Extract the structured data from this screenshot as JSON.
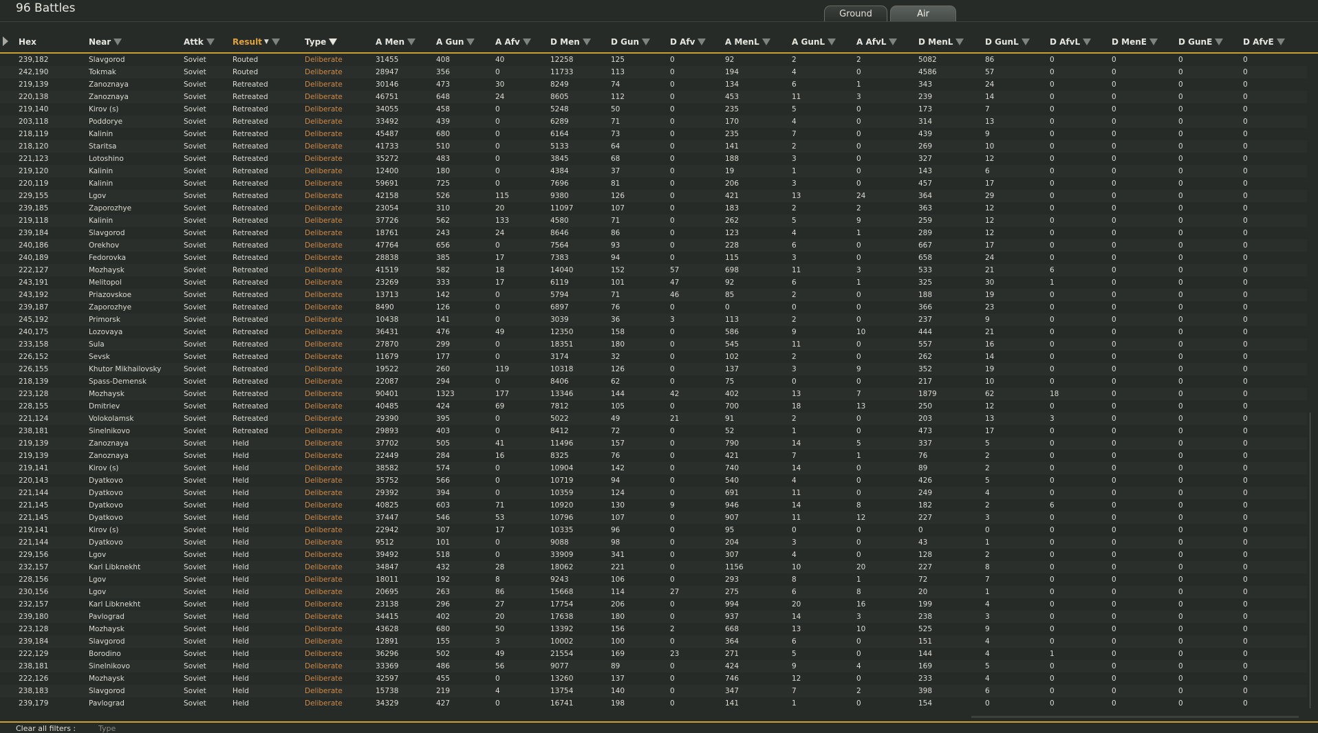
{
  "title": "96 Battles",
  "tabs": [
    {
      "label": "Ground",
      "active": false
    },
    {
      "label": "Air",
      "active": true
    }
  ],
  "colors": {
    "accent": "#c9a233",
    "type_text": "#cf8a4a",
    "active_header": "#e1a23e",
    "background": "#262b28"
  },
  "columns": [
    {
      "key": "hex",
      "label": "Hex",
      "filter": false
    },
    {
      "key": "near",
      "label": "Near",
      "filter": true
    },
    {
      "key": "attk",
      "label": "Attk",
      "filter": true
    },
    {
      "key": "result",
      "label": "Result",
      "filter": true,
      "sorted": "descending",
      "active": true
    },
    {
      "key": "type",
      "label": "Type",
      "filter": true,
      "filter_applied": true
    },
    {
      "key": "a_men",
      "label": "A Men",
      "filter": true
    },
    {
      "key": "a_gun",
      "label": "A Gun",
      "filter": true
    },
    {
      "key": "a_afv",
      "label": "A Afv",
      "filter": true
    },
    {
      "key": "d_men",
      "label": "D Men",
      "filter": true
    },
    {
      "key": "d_gun",
      "label": "D Gun",
      "filter": true
    },
    {
      "key": "d_afv",
      "label": "D Afv",
      "filter": true
    },
    {
      "key": "a_menl",
      "label": "A MenL",
      "filter": true
    },
    {
      "key": "a_gunl",
      "label": "A GunL",
      "filter": true
    },
    {
      "key": "a_afvl",
      "label": "A AfvL",
      "filter": true
    },
    {
      "key": "d_menl",
      "label": "D MenL",
      "filter": true
    },
    {
      "key": "d_gunl",
      "label": "D GunL",
      "filter": true
    },
    {
      "key": "d_afvl",
      "label": "D AfvL",
      "filter": true
    },
    {
      "key": "d_mene",
      "label": "D MenE",
      "filter": true
    },
    {
      "key": "d_gune",
      "label": "D GunE",
      "filter": true
    },
    {
      "key": "d_afve",
      "label": "D AfvE",
      "filter": true
    }
  ],
  "rows": [
    [
      "239,182",
      "Slavgorod",
      "Soviet",
      "Routed",
      "Deliberate",
      "31455",
      "408",
      "40",
      "12258",
      "125",
      "0",
      "92",
      "2",
      "2",
      "5082",
      "86",
      "0",
      "0",
      "0",
      "0"
    ],
    [
      "242,190",
      "Tokmak",
      "Soviet",
      "Routed",
      "Deliberate",
      "28947",
      "356",
      "0",
      "11733",
      "113",
      "0",
      "194",
      "4",
      "0",
      "4586",
      "57",
      "0",
      "0",
      "0",
      "0"
    ],
    [
      "219,139",
      "Zanoznaya",
      "Soviet",
      "Retreated",
      "Deliberate",
      "30146",
      "473",
      "30",
      "8249",
      "74",
      "0",
      "134",
      "6",
      "1",
      "343",
      "24",
      "0",
      "0",
      "0",
      "0"
    ],
    [
      "220,138",
      "Zanoznaya",
      "Soviet",
      "Retreated",
      "Deliberate",
      "46751",
      "648",
      "24",
      "8605",
      "112",
      "0",
      "453",
      "11",
      "3",
      "239",
      "14",
      "0",
      "0",
      "0",
      "0"
    ],
    [
      "219,140",
      "Kirov (s)",
      "Soviet",
      "Retreated",
      "Deliberate",
      "34055",
      "458",
      "0",
      "5248",
      "50",
      "0",
      "235",
      "5",
      "0",
      "173",
      "7",
      "0",
      "0",
      "0",
      "0"
    ],
    [
      "203,118",
      "Poddorye",
      "Soviet",
      "Retreated",
      "Deliberate",
      "33492",
      "439",
      "0",
      "6289",
      "71",
      "0",
      "170",
      "4",
      "0",
      "314",
      "13",
      "0",
      "0",
      "0",
      "0"
    ],
    [
      "218,119",
      "Kalinin",
      "Soviet",
      "Retreated",
      "Deliberate",
      "45487",
      "680",
      "0",
      "6164",
      "73",
      "0",
      "235",
      "7",
      "0",
      "439",
      "9",
      "0",
      "0",
      "0",
      "0"
    ],
    [
      "218,120",
      "Staritsa",
      "Soviet",
      "Retreated",
      "Deliberate",
      "41733",
      "510",
      "0",
      "5133",
      "64",
      "0",
      "141",
      "2",
      "0",
      "269",
      "10",
      "0",
      "0",
      "0",
      "0"
    ],
    [
      "221,123",
      "Lotoshino",
      "Soviet",
      "Retreated",
      "Deliberate",
      "35272",
      "483",
      "0",
      "3845",
      "68",
      "0",
      "188",
      "3",
      "0",
      "327",
      "12",
      "0",
      "0",
      "0",
      "0"
    ],
    [
      "219,120",
      "Kalinin",
      "Soviet",
      "Retreated",
      "Deliberate",
      "12400",
      "180",
      "0",
      "4384",
      "37",
      "0",
      "19",
      "1",
      "0",
      "143",
      "6",
      "0",
      "0",
      "0",
      "0"
    ],
    [
      "220,119",
      "Kalinin",
      "Soviet",
      "Retreated",
      "Deliberate",
      "59691",
      "725",
      "0",
      "7696",
      "81",
      "0",
      "206",
      "3",
      "0",
      "457",
      "17",
      "0",
      "0",
      "0",
      "0"
    ],
    [
      "229,155",
      "Lgov",
      "Soviet",
      "Retreated",
      "Deliberate",
      "42158",
      "526",
      "115",
      "9380",
      "126",
      "0",
      "421",
      "13",
      "24",
      "364",
      "29",
      "0",
      "0",
      "0",
      "0"
    ],
    [
      "239,185",
      "Zaporozhye",
      "Soviet",
      "Retreated",
      "Deliberate",
      "23054",
      "310",
      "20",
      "11097",
      "107",
      "0",
      "183",
      "2",
      "2",
      "363",
      "12",
      "0",
      "0",
      "0",
      "0"
    ],
    [
      "219,118",
      "Kalinin",
      "Soviet",
      "Retreated",
      "Deliberate",
      "37726",
      "562",
      "133",
      "4580",
      "71",
      "0",
      "262",
      "5",
      "9",
      "259",
      "12",
      "0",
      "0",
      "0",
      "0"
    ],
    [
      "239,184",
      "Slavgorod",
      "Soviet",
      "Retreated",
      "Deliberate",
      "18761",
      "243",
      "24",
      "8646",
      "86",
      "0",
      "123",
      "4",
      "1",
      "289",
      "12",
      "0",
      "0",
      "0",
      "0"
    ],
    [
      "240,186",
      "Orekhov",
      "Soviet",
      "Retreated",
      "Deliberate",
      "47764",
      "656",
      "0",
      "7564",
      "93",
      "0",
      "228",
      "6",
      "0",
      "667",
      "17",
      "0",
      "0",
      "0",
      "0"
    ],
    [
      "240,189",
      "Fedorovka",
      "Soviet",
      "Retreated",
      "Deliberate",
      "28838",
      "385",
      "17",
      "7383",
      "94",
      "0",
      "115",
      "3",
      "0",
      "658",
      "24",
      "0",
      "0",
      "0",
      "0"
    ],
    [
      "222,127",
      "Mozhaysk",
      "Soviet",
      "Retreated",
      "Deliberate",
      "41519",
      "582",
      "18",
      "14040",
      "152",
      "57",
      "698",
      "11",
      "3",
      "533",
      "21",
      "6",
      "0",
      "0",
      "0"
    ],
    [
      "243,191",
      "Melitopol",
      "Soviet",
      "Retreated",
      "Deliberate",
      "23269",
      "333",
      "17",
      "6119",
      "101",
      "47",
      "92",
      "6",
      "1",
      "325",
      "30",
      "1",
      "0",
      "0",
      "0"
    ],
    [
      "243,192",
      "Priazovskoe",
      "Soviet",
      "Retreated",
      "Deliberate",
      "13713",
      "142",
      "0",
      "5794",
      "71",
      "46",
      "85",
      "2",
      "0",
      "188",
      "19",
      "0",
      "0",
      "0",
      "0"
    ],
    [
      "239,187",
      "Zaporozhye",
      "Soviet",
      "Retreated",
      "Deliberate",
      "8490",
      "126",
      "0",
      "6897",
      "76",
      "0",
      "0",
      "0",
      "0",
      "366",
      "23",
      "0",
      "0",
      "0",
      "0"
    ],
    [
      "245,192",
      "Primorsk",
      "Soviet",
      "Retreated",
      "Deliberate",
      "10438",
      "141",
      "0",
      "3039",
      "36",
      "3",
      "113",
      "2",
      "0",
      "237",
      "9",
      "0",
      "0",
      "0",
      "0"
    ],
    [
      "240,175",
      "Lozovaya",
      "Soviet",
      "Retreated",
      "Deliberate",
      "36431",
      "476",
      "49",
      "12350",
      "158",
      "0",
      "586",
      "9",
      "10",
      "444",
      "21",
      "0",
      "0",
      "0",
      "0"
    ],
    [
      "233,158",
      "Sula",
      "Soviet",
      "Retreated",
      "Deliberate",
      "27870",
      "299",
      "0",
      "18351",
      "180",
      "0",
      "545",
      "11",
      "0",
      "557",
      "16",
      "0",
      "0",
      "0",
      "0"
    ],
    [
      "226,152",
      "Sevsk",
      "Soviet",
      "Retreated",
      "Deliberate",
      "11679",
      "177",
      "0",
      "3174",
      "32",
      "0",
      "102",
      "2",
      "0",
      "262",
      "14",
      "0",
      "0",
      "0",
      "0"
    ],
    [
      "226,155",
      "Khutor Mikhailovsky",
      "Soviet",
      "Retreated",
      "Deliberate",
      "19522",
      "260",
      "119",
      "10318",
      "126",
      "0",
      "137",
      "3",
      "9",
      "352",
      "19",
      "0",
      "0",
      "0",
      "0"
    ],
    [
      "218,139",
      "Spass-Demensk",
      "Soviet",
      "Retreated",
      "Deliberate",
      "22087",
      "294",
      "0",
      "8406",
      "62",
      "0",
      "75",
      "0",
      "0",
      "217",
      "10",
      "0",
      "0",
      "0",
      "0"
    ],
    [
      "223,128",
      "Mozhaysk",
      "Soviet",
      "Retreated",
      "Deliberate",
      "90401",
      "1323",
      "177",
      "13346",
      "144",
      "42",
      "402",
      "13",
      "7",
      "1879",
      "62",
      "18",
      "0",
      "0",
      "0"
    ],
    [
      "228,155",
      "Dmitriev",
      "Soviet",
      "Retreated",
      "Deliberate",
      "40485",
      "424",
      "69",
      "7812",
      "105",
      "0",
      "700",
      "18",
      "13",
      "250",
      "12",
      "0",
      "0",
      "0",
      "0"
    ],
    [
      "221,124",
      "Volokolamsk",
      "Soviet",
      "Retreated",
      "Deliberate",
      "29390",
      "395",
      "0",
      "5022",
      "49",
      "21",
      "91",
      "2",
      "0",
      "203",
      "13",
      "3",
      "0",
      "0",
      "0"
    ],
    [
      "238,181",
      "Sinelnikovo",
      "Soviet",
      "Retreated",
      "Deliberate",
      "29893",
      "403",
      "0",
      "8412",
      "72",
      "0",
      "52",
      "1",
      "0",
      "473",
      "17",
      "0",
      "0",
      "0",
      "0"
    ],
    [
      "219,139",
      "Zanoznaya",
      "Soviet",
      "Held",
      "Deliberate",
      "37702",
      "505",
      "41",
      "11496",
      "157",
      "0",
      "790",
      "14",
      "5",
      "337",
      "5",
      "0",
      "0",
      "0",
      "0"
    ],
    [
      "219,139",
      "Zanoznaya",
      "Soviet",
      "Held",
      "Deliberate",
      "22449",
      "284",
      "16",
      "8325",
      "76",
      "0",
      "421",
      "7",
      "1",
      "76",
      "2",
      "0",
      "0",
      "0",
      "0"
    ],
    [
      "219,141",
      "Kirov (s)",
      "Soviet",
      "Held",
      "Deliberate",
      "38582",
      "574",
      "0",
      "10904",
      "142",
      "0",
      "740",
      "14",
      "0",
      "89",
      "2",
      "0",
      "0",
      "0",
      "0"
    ],
    [
      "220,143",
      "Dyatkovo",
      "Soviet",
      "Held",
      "Deliberate",
      "35752",
      "566",
      "0",
      "10719",
      "94",
      "0",
      "540",
      "4",
      "0",
      "426",
      "5",
      "0",
      "0",
      "0",
      "0"
    ],
    [
      "221,144",
      "Dyatkovo",
      "Soviet",
      "Held",
      "Deliberate",
      "29392",
      "394",
      "0",
      "10359",
      "124",
      "0",
      "691",
      "11",
      "0",
      "249",
      "4",
      "0",
      "0",
      "0",
      "0"
    ],
    [
      "221,145",
      "Dyatkovo",
      "Soviet",
      "Held",
      "Deliberate",
      "40825",
      "603",
      "71",
      "10920",
      "130",
      "9",
      "946",
      "14",
      "8",
      "182",
      "2",
      "6",
      "0",
      "0",
      "0"
    ],
    [
      "221,145",
      "Dyatkovo",
      "Soviet",
      "Held",
      "Deliberate",
      "37447",
      "546",
      "53",
      "10796",
      "107",
      "0",
      "907",
      "11",
      "12",
      "227",
      "3",
      "0",
      "0",
      "0",
      "0"
    ],
    [
      "219,141",
      "Kirov (s)",
      "Soviet",
      "Held",
      "Deliberate",
      "22942",
      "307",
      "17",
      "10335",
      "96",
      "0",
      "95",
      "0",
      "0",
      "0",
      "0",
      "0",
      "0",
      "0",
      "0"
    ],
    [
      "221,144",
      "Dyatkovo",
      "Soviet",
      "Held",
      "Deliberate",
      "9512",
      "101",
      "0",
      "9088",
      "98",
      "0",
      "204",
      "3",
      "0",
      "43",
      "1",
      "0",
      "0",
      "0",
      "0"
    ],
    [
      "229,156",
      "Lgov",
      "Soviet",
      "Held",
      "Deliberate",
      "39492",
      "518",
      "0",
      "33909",
      "341",
      "0",
      "307",
      "4",
      "0",
      "128",
      "2",
      "0",
      "0",
      "0",
      "0"
    ],
    [
      "232,157",
      "Karl Libknekht",
      "Soviet",
      "Held",
      "Deliberate",
      "34847",
      "432",
      "28",
      "18062",
      "221",
      "0",
      "1156",
      "10",
      "20",
      "227",
      "8",
      "0",
      "0",
      "0",
      "0"
    ],
    [
      "228,156",
      "Lgov",
      "Soviet",
      "Held",
      "Deliberate",
      "18011",
      "192",
      "8",
      "9243",
      "106",
      "0",
      "293",
      "8",
      "1",
      "72",
      "7",
      "0",
      "0",
      "0",
      "0"
    ],
    [
      "230,156",
      "Lgov",
      "Soviet",
      "Held",
      "Deliberate",
      "20695",
      "263",
      "86",
      "15668",
      "114",
      "27",
      "275",
      "6",
      "8",
      "20",
      "1",
      "0",
      "0",
      "0",
      "0"
    ],
    [
      "232,157",
      "Karl Libknekht",
      "Soviet",
      "Held",
      "Deliberate",
      "23138",
      "296",
      "27",
      "17754",
      "206",
      "0",
      "994",
      "20",
      "16",
      "199",
      "4",
      "0",
      "0",
      "0",
      "0"
    ],
    [
      "239,180",
      "Pavlograd",
      "Soviet",
      "Held",
      "Deliberate",
      "34415",
      "402",
      "20",
      "17638",
      "180",
      "0",
      "937",
      "14",
      "3",
      "238",
      "3",
      "0",
      "0",
      "0",
      "0"
    ],
    [
      "223,128",
      "Mozhaysk",
      "Soviet",
      "Held",
      "Deliberate",
      "43628",
      "680",
      "50",
      "13392",
      "156",
      "2",
      "668",
      "13",
      "10",
      "525",
      "9",
      "0",
      "0",
      "0",
      "0"
    ],
    [
      "239,184",
      "Slavgorod",
      "Soviet",
      "Held",
      "Deliberate",
      "12891",
      "155",
      "3",
      "10002",
      "100",
      "0",
      "364",
      "6",
      "0",
      "151",
      "4",
      "0",
      "0",
      "0",
      "0"
    ],
    [
      "222,129",
      "Borodino",
      "Soviet",
      "Held",
      "Deliberate",
      "36296",
      "502",
      "49",
      "21554",
      "169",
      "23",
      "271",
      "5",
      "0",
      "144",
      "4",
      "1",
      "0",
      "0",
      "0"
    ],
    [
      "238,181",
      "Sinelnikovo",
      "Soviet",
      "Held",
      "Deliberate",
      "33369",
      "486",
      "56",
      "9077",
      "89",
      "0",
      "424",
      "9",
      "4",
      "169",
      "5",
      "0",
      "0",
      "0",
      "0"
    ],
    [
      "222,126",
      "Mozhaysk",
      "Soviet",
      "Held",
      "Deliberate",
      "32597",
      "455",
      "0",
      "13260",
      "137",
      "0",
      "746",
      "12",
      "0",
      "233",
      "4",
      "0",
      "0",
      "0",
      "0"
    ],
    [
      "238,183",
      "Slavgorod",
      "Soviet",
      "Held",
      "Deliberate",
      "15738",
      "219",
      "4",
      "13754",
      "140",
      "0",
      "347",
      "7",
      "2",
      "398",
      "6",
      "0",
      "0",
      "0",
      "0"
    ],
    [
      "239,179",
      "Pavlograd",
      "Soviet",
      "Held",
      "Deliberate",
      "34329",
      "427",
      "0",
      "16741",
      "198",
      "0",
      "141",
      "1",
      "0",
      "154",
      "0",
      "0",
      "0",
      "0",
      "0"
    ]
  ],
  "footer": {
    "clear_filters": "Clear all filters :",
    "active_filter": "Type"
  }
}
